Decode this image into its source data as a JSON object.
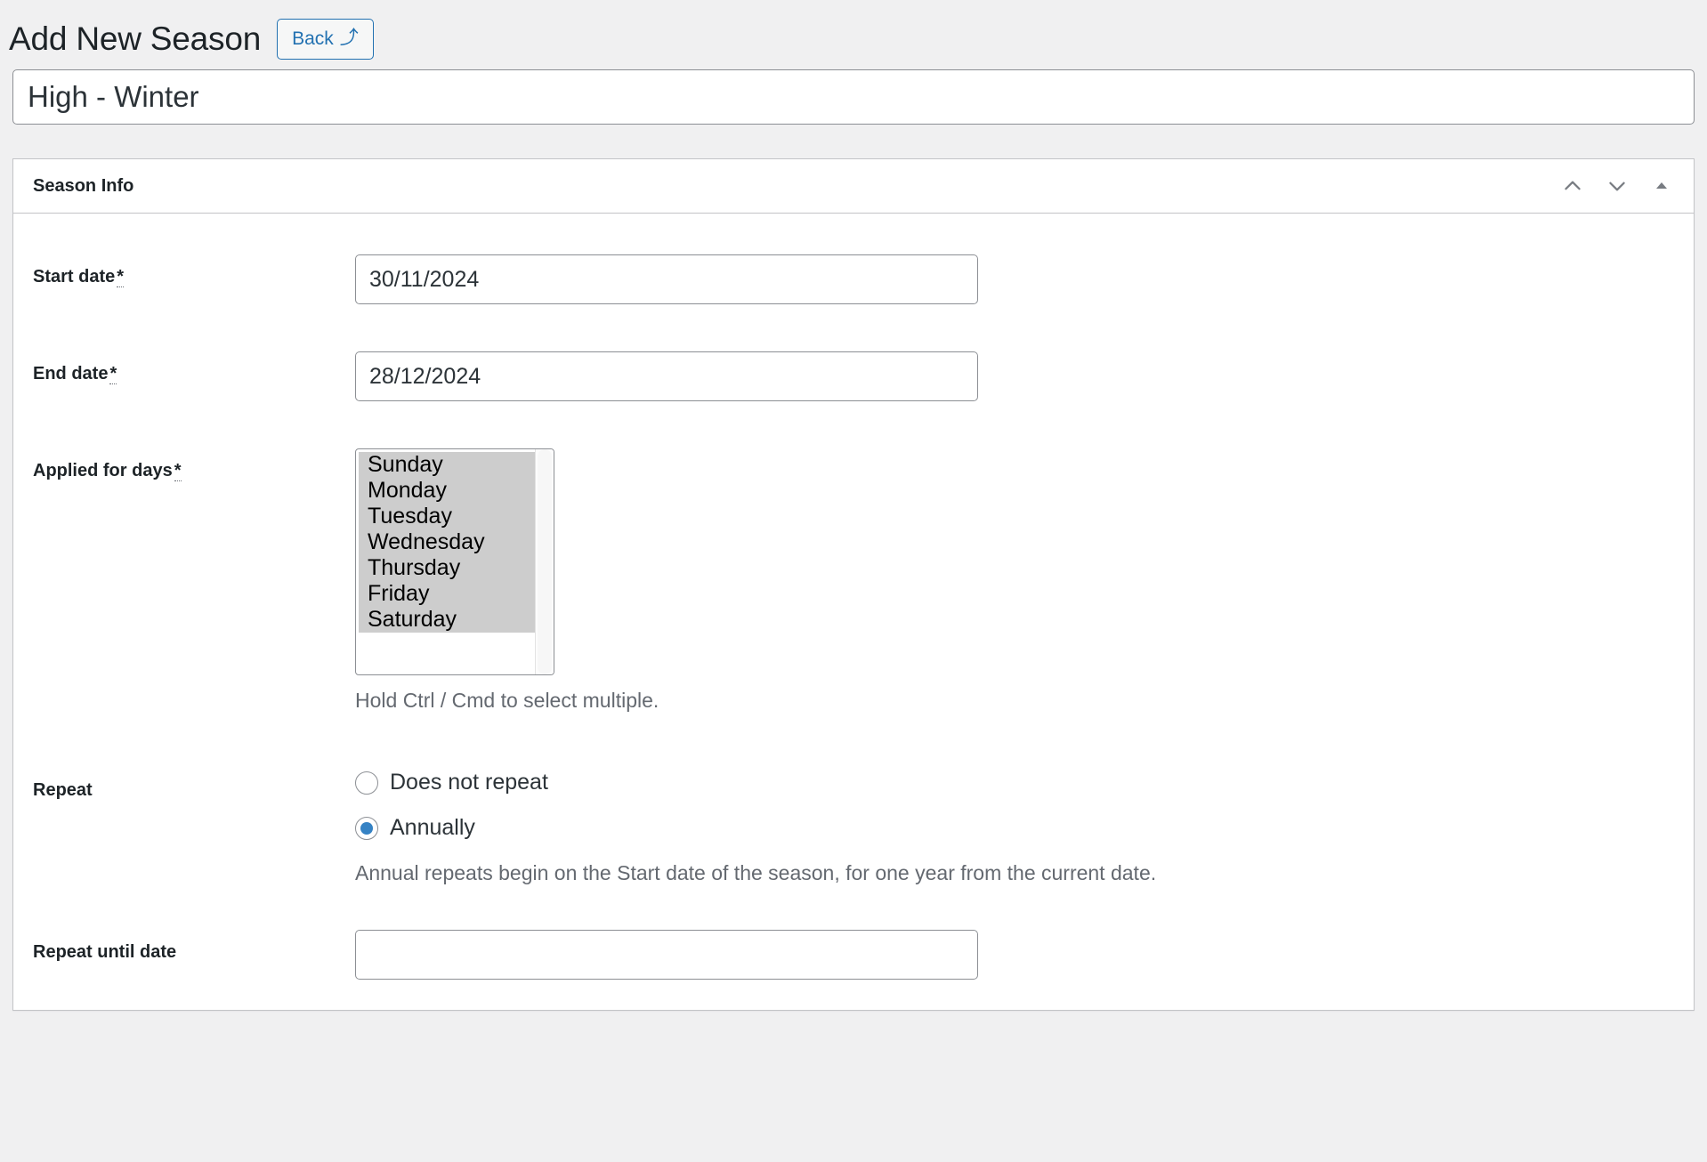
{
  "header": {
    "title": "Add New Season",
    "back_label": "Back",
    "back_icon_glyph": "⤴",
    "accent_color": "#2271b1"
  },
  "title_field": {
    "value": "High - Winter",
    "placeholder": "Enter season name"
  },
  "panel": {
    "title": "Season Info",
    "actions": [
      {
        "name": "move-up",
        "icon": "chevron-up-icon"
      },
      {
        "name": "move-down",
        "icon": "chevron-down-icon"
      },
      {
        "name": "toggle-panel",
        "icon": "triangle-up-icon"
      }
    ]
  },
  "fields": {
    "start_date": {
      "label": "Start date",
      "required_mark": "*",
      "value": "30/11/2024",
      "placeholder": ""
    },
    "end_date": {
      "label": "End date",
      "required_mark": "*",
      "value": "28/12/2024",
      "placeholder": ""
    },
    "applied_for_days": {
      "label": "Applied for days",
      "required_mark": "*",
      "hint": "Hold Ctrl / Cmd to select multiple.",
      "options": [
        {
          "label": "Sunday",
          "selected": true
        },
        {
          "label": "Monday",
          "selected": true
        },
        {
          "label": "Tuesday",
          "selected": true
        },
        {
          "label": "Wednesday",
          "selected": true
        },
        {
          "label": "Thursday",
          "selected": true
        },
        {
          "label": "Friday",
          "selected": true
        },
        {
          "label": "Saturday",
          "selected": true
        }
      ]
    },
    "repeat": {
      "label": "Repeat",
      "options": [
        {
          "label": "Does not repeat",
          "selected": false
        },
        {
          "label": "Annually",
          "selected": true
        }
      ],
      "description": "Annual repeats begin on the Start date of the season, for one year from the current date."
    },
    "repeat_until_date": {
      "label": "Repeat until date",
      "value": "",
      "placeholder": ""
    }
  }
}
